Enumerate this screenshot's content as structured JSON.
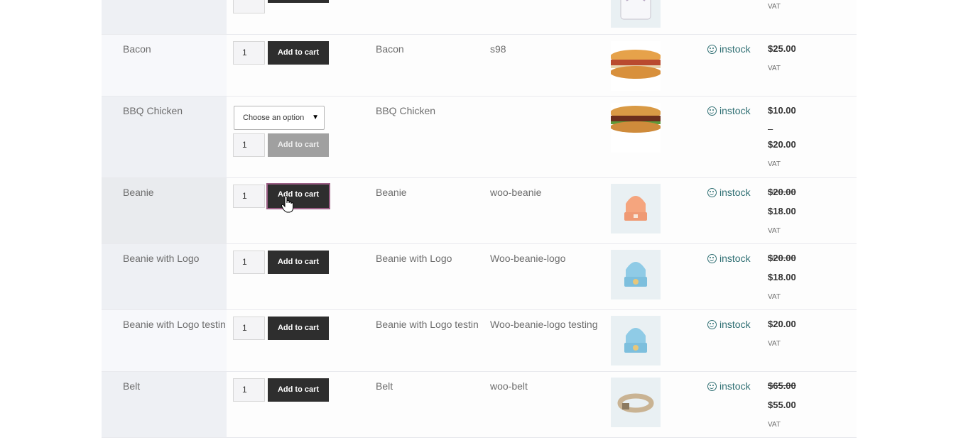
{
  "top_row": {
    "vat": "VAT"
  },
  "rows": [
    {
      "name": "Bacon",
      "qty": "1",
      "button": "Add to cart",
      "title": "Bacon",
      "sku": "s98",
      "stock": "instock",
      "price": "$25.00",
      "vat": "VAT",
      "image": "sandwich-image"
    },
    {
      "name": "BBQ Chicken",
      "select": "Choose an option",
      "qty": "1",
      "button": "Add to cart",
      "title": "BBQ Chicken",
      "sku": "",
      "stock": "instock",
      "price_min": "$10.00",
      "dash": "–",
      "price_max": "$20.00",
      "vat": "VAT",
      "image": "sandwich-image"
    },
    {
      "name": "Beanie",
      "qty": "1",
      "button": "Add to cart",
      "title": "Beanie",
      "sku": "woo-beanie",
      "stock": "instock",
      "price_old": "$20.00",
      "price": "$18.00",
      "vat": "VAT",
      "image": "beanie-image"
    },
    {
      "name": "Beanie with Logo",
      "qty": "1",
      "button": "Add to cart",
      "title": "Beanie with Logo",
      "sku": "Woo-beanie-logo",
      "stock": "instock",
      "price_old": "$20.00",
      "price": "$18.00",
      "vat": "VAT",
      "image": "beanie-logo-image"
    },
    {
      "name": "Beanie with Logo testin",
      "qty": "1",
      "button": "Add to cart",
      "title": "Beanie with Logo testin",
      "sku": "Woo-beanie-logo testing",
      "stock": "instock",
      "price": "$20.00",
      "vat": "VAT",
      "image": "beanie-logo-image"
    },
    {
      "name": "Belt",
      "qty": "1",
      "button": "Add to cart",
      "title": "Belt",
      "sku": "woo-belt",
      "stock": "instock",
      "price_old": "$65.00",
      "price": "$55.00",
      "vat": "VAT",
      "image": "belt-image"
    }
  ],
  "colors": {
    "accent": "#2f6f73",
    "button": "#2e2e2e",
    "button_disabled": "#a0a0a0",
    "focus_border": "#9b5e85"
  }
}
